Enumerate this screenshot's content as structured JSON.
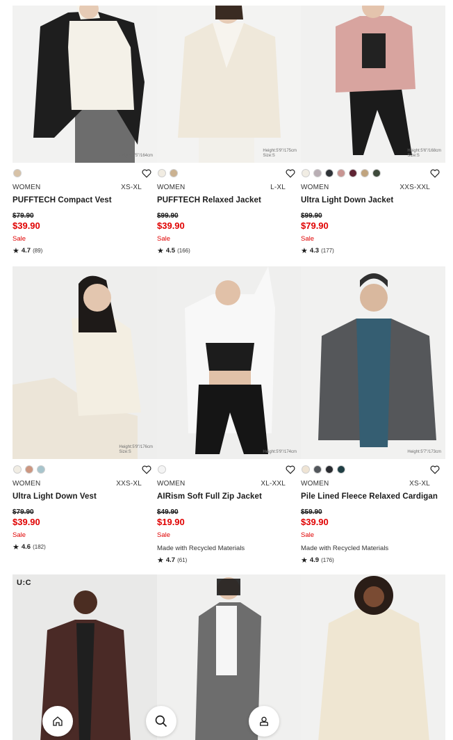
{
  "products": [
    {
      "name": "PUFFTECH Compact Vest",
      "gender": "WOMEN",
      "sizes": "XS-XL",
      "original_price": "$79.90",
      "price": "$39.90",
      "sale": "Sale",
      "rating": "4.7",
      "reviews": "(89)",
      "note": "",
      "model_info": [
        "Height:5'5\"/164cm",
        ""
      ],
      "swatches": [
        "#d7c2a7"
      ]
    },
    {
      "name": "PUFFTECH Relaxed Jacket",
      "gender": "WOMEN",
      "sizes": "L-XL",
      "original_price": "$99.90",
      "price": "$39.90",
      "sale": "Sale",
      "rating": "4.5",
      "reviews": "(166)",
      "note": "",
      "model_info": [
        "Height:5'9\"/175cm",
        "Size:S"
      ],
      "swatches": [
        "#f1ece2",
        "#cbb291"
      ]
    },
    {
      "name": "Ultra Light Down Jacket",
      "gender": "WOMEN",
      "sizes": "XXS-XXL",
      "original_price": "$99.90",
      "price": "$79.90",
      "sale": "Sale",
      "rating": "4.3",
      "reviews": "(177)",
      "note": "",
      "model_info": [
        "Height:5'6\"/168cm",
        "Size:S"
      ],
      "swatches": [
        "#f1ede4",
        "#b9aeb4",
        "#2f3338",
        "#c89592",
        "#5f2433",
        "#c0a47f",
        "#3e4a3b"
      ]
    },
    {
      "name": "Ultra Light Down Vest",
      "gender": "WOMEN",
      "sizes": "XXS-XL",
      "original_price": "$79.90",
      "price": "$39.90",
      "sale": "Sale",
      "rating": "4.6",
      "reviews": "(182)",
      "note": "",
      "model_info": [
        "Height:5'9\"/176cm",
        "Size:S"
      ],
      "swatches": [
        "#f1ede4",
        "#cc9680",
        "#a7c4cc"
      ]
    },
    {
      "name": "AIRism Soft Full Zip Jacket",
      "gender": "WOMEN",
      "sizes": "XL-XXL",
      "original_price": "$49.90",
      "price": "$19.90",
      "sale": "Sale",
      "rating": "4.7",
      "reviews": "(61)",
      "note": "Made with Recycled Materials",
      "model_info": [
        "Height:5'9\"/174cm",
        ""
      ],
      "swatches": [
        "#f4f4f4"
      ]
    },
    {
      "name": "Pile Lined Fleece Relaxed Cardigan",
      "gender": "WOMEN",
      "sizes": "XS-XL",
      "original_price": "$59.90",
      "price": "$39.90",
      "sale": "Sale",
      "rating": "4.9",
      "reviews": "(176)",
      "note": "Made with Recycled Materials",
      "model_info": [
        "Height:5'7\"/173cm",
        ""
      ],
      "swatches": [
        "#efe4d4",
        "#53575c",
        "#2a2c31",
        "#1f3e44"
      ]
    }
  ],
  "row3_badge": "U:C",
  "nav": {
    "home": "home-icon",
    "search": "search-icon",
    "account": "user-icon"
  }
}
